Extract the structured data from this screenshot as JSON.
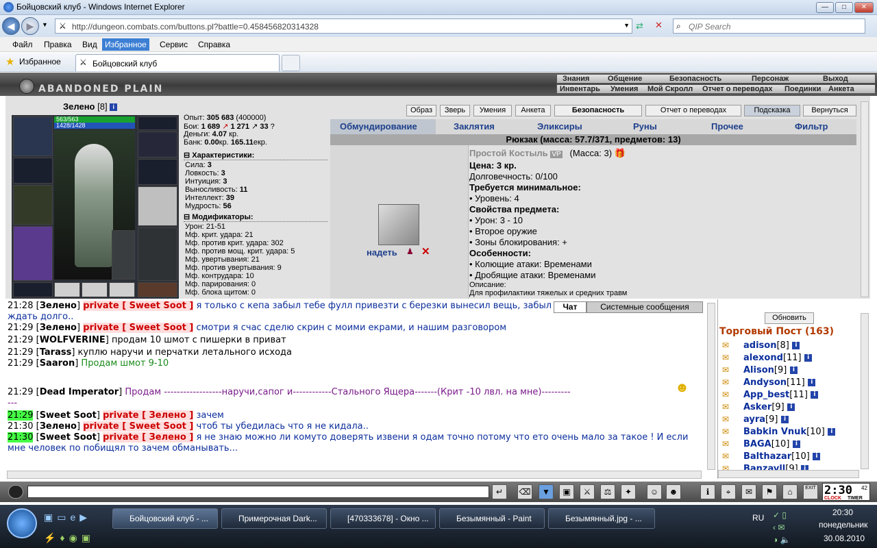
{
  "window": {
    "title": "Бойцовский клуб - Windows Internet Explorer",
    "min": "—",
    "max": "□",
    "close": "✕"
  },
  "address": {
    "url": "http://dungeon.combats.com/buttons.pl?battle=0.458456820314328",
    "search_placeholder": "QIP Search"
  },
  "menu": [
    "Файл",
    "Правка",
    "Вид",
    "Избранное",
    "Сервис",
    "Справка"
  ],
  "favorites": {
    "label": "Избранное",
    "tab": "Бойцовский клуб"
  },
  "game": {
    "logo": "ABANDONED PLAIN",
    "nav1": [
      "Знания",
      "Общение",
      "Безопасность",
      "Персонаж",
      "Выход"
    ],
    "nav2": [
      "Инвентарь",
      "Умения",
      "Мой Скролл",
      "Отчет о переводах",
      "Поединки",
      "Анкета"
    ]
  },
  "character": {
    "name": "Зелено",
    "level": "[8]",
    "hp": "563/563",
    "mana": "1428/1428",
    "exp_label": "Опыт:",
    "exp": "305 683",
    "exp_next": "(400000)",
    "fights_label": "Бои:",
    "wins": "1 689",
    "losses": "1 271",
    "draws": "33",
    "money_label": "Деньги:",
    "money": "4.07",
    "money_unit": "кр.",
    "bank_label": "Банк:",
    "bank_kr": "0.00",
    "bank_kr_unit": "кр.",
    "bank_ekr": "165.11",
    "bank_ekr_unit": "екр.",
    "chars_title": "Характеристики:",
    "stats": [
      [
        "Сила:",
        "3"
      ],
      [
        "Ловкость:",
        "3"
      ],
      [
        "Интуиция:",
        "3"
      ],
      [
        "Выносливость:",
        "11"
      ],
      [
        "Интеллект:",
        "39"
      ],
      [
        "Мудрость:",
        "56"
      ]
    ],
    "mods_title": "Модификаторы:",
    "mods": [
      "Урон: 21-51",
      "Мф. крит. удара: 21",
      "Мф. против крит. удара: 302",
      "Мф. против мощ. крит. удара: 5",
      "Мф. увертывания: 21",
      "Мф. против увертывания: 9",
      "Мф. контрудара: 10",
      "Мф. парирования: 0",
      "Мф. блока щитом: 0"
    ]
  },
  "buttons": [
    "Образ",
    "Зверь",
    "Умения",
    "Анкета",
    "Безопасность",
    "Отчет о переводах",
    "Подсказка",
    "Вернуться"
  ],
  "inventory_tabs": [
    "Обмундирование",
    "Заклятия",
    "Эликсиры",
    "Руны",
    "Прочее",
    "Фильтр"
  ],
  "backpack": "Рюкзак (масса: 57.7/371, предметов: 13)",
  "item": {
    "equip": "надеть",
    "name": "Простой Костыль",
    "badge": "VP",
    "mass": "(Масса: 3)",
    "price": "Цена: 3 кр.",
    "durability": "Долговечность: 0/100",
    "req_title": "Требуется минимальное:",
    "req": [
      "• Уровень: 4"
    ],
    "props_title": "Свойства предмета:",
    "props": [
      "• Урон: 3 - 10",
      "• Второе оружие",
      "• Зоны блокирования: +"
    ],
    "features_title": "Особенности:",
    "features": [
      "• Колющие атаки: Временами",
      "• Дробящие атаки: Временами"
    ],
    "desc_title": "Описание:",
    "desc": "Для профилактики тяжелых и средних травм"
  },
  "chat": {
    "tabs": [
      "Чат",
      "Системные сообщения"
    ],
    "lines": [
      {
        "time": "21:28",
        "nick": "Зелено",
        "priv": "private [ Sweet Soot ]",
        "text": "я только с кепа забыл тебе фулл привезти с березки вынесил вещь, забыл"
      },
      {
        "time": "",
        "nick": "",
        "priv": "",
        "text": "ждать долго.."
      },
      {
        "time": "21:29",
        "nick": "Зелено",
        "priv": "private [ Sweet Soot ]",
        "text": "смотри я счас сделю скрин с моими екрами, и нашим разговором"
      },
      {
        "time": "21:29",
        "nick": "WOLFVERINE",
        "priv": "",
        "text": "продам 10 шмот с пишерки в приват"
      },
      {
        "time": "21:29",
        "nick": "Tarass",
        "priv": "",
        "text": "куплю наручи и перчатки летального исхода"
      },
      {
        "time": "21:29",
        "nick": "Saaron",
        "priv": "",
        "text": "Продам шмот 9-10"
      },
      {
        "time": "21:29",
        "nick": "Dead Imperator",
        "priv": "",
        "text": "Продам ------------------наручи,сапог и------------Стального Ящера-------(Крит -10 лвл. на мне)---------"
      },
      {
        "time": "",
        "nick": "",
        "priv": "",
        "text": "---"
      },
      {
        "time": "21:29",
        "nick": "Sweet Soot",
        "priv": "private [ Зелено ]",
        "text": "зачем"
      },
      {
        "time": "21:30",
        "nick": "Зелено",
        "priv": "private [ Sweet Soot ]",
        "text": "чтоб ты убедилась что я не кидала.."
      },
      {
        "time": "21:30",
        "nick": "Sweet Soot",
        "priv": "private [ Зелено ]",
        "text": "я не знаю можно ли комуто доверять извени я одам точно потому что ето очень мало за такое ! И если"
      },
      {
        "time": "",
        "nick": "",
        "priv": "",
        "text": "мне человек по побищял то зачем обманывать..."
      }
    ]
  },
  "users": {
    "refresh": "Обновить",
    "title": "Торговый Пост (163)",
    "list": [
      [
        "adison",
        "[8]"
      ],
      [
        "alexond",
        "[11]"
      ],
      [
        "Alison",
        "[9]"
      ],
      [
        "Andyson",
        "[11]"
      ],
      [
        "App_best",
        "[11]"
      ],
      [
        "Asker",
        "[9]"
      ],
      [
        "ayra",
        "[9]"
      ],
      [
        "Babkin Vnuk",
        "[10]"
      ],
      [
        "BAGA",
        "[10]"
      ],
      [
        "Balthazar",
        "[10]"
      ],
      [
        "Banzayll",
        "[9]"
      ]
    ]
  },
  "clock": {
    "time": "2:30",
    "sec": "42",
    "label1": "CLOCK",
    "label2": "TIMER",
    "exit": "EXIT"
  },
  "taskbar": {
    "items": [
      "Бойцовский клуб - ...",
      "Примерочная Dark...",
      "[470333678] - Окно ...",
      "Безымянный - Paint",
      "Безымянный.jpg - ..."
    ],
    "lang": "RU",
    "time": "20:30",
    "day": "понедельник",
    "date": "30.08.2010"
  }
}
